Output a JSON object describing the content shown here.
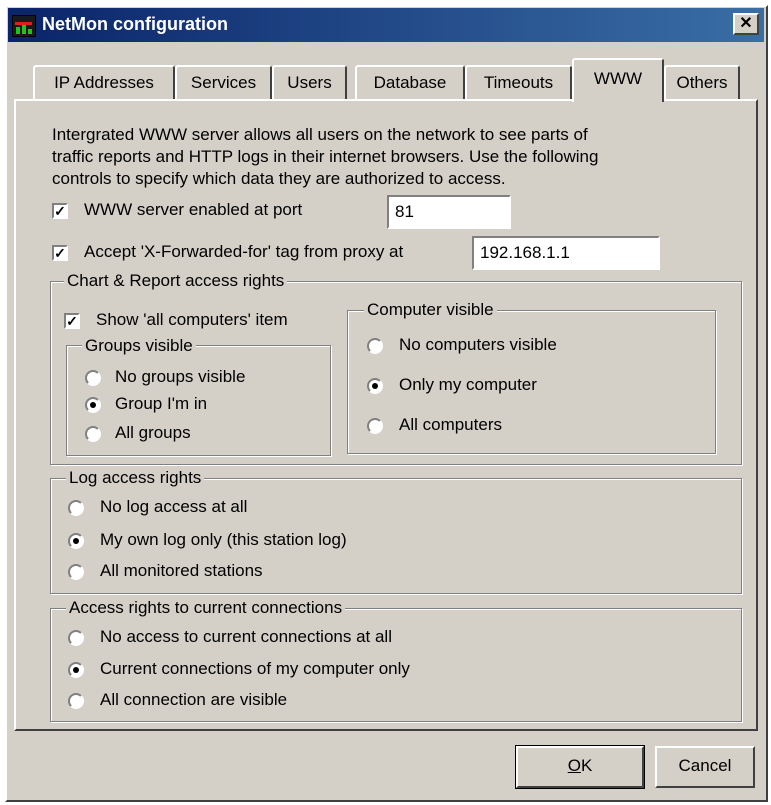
{
  "window": {
    "title": "NetMon configuration",
    "close_glyph": "✕",
    "icon": "netmon-app-icon"
  },
  "tabs": [
    {
      "label": "IP Addresses",
      "active": false
    },
    {
      "label": "Services",
      "active": false
    },
    {
      "label": "Users",
      "active": false
    },
    {
      "label": "Database",
      "active": false
    },
    {
      "label": "Timeouts",
      "active": false
    },
    {
      "label": "WWW",
      "active": true
    },
    {
      "label": "Others",
      "active": false
    }
  ],
  "intro": [
    "Intergrated WWW server allows all users on the network to see parts of",
    "traffic reports and  HTTP logs in their internet browsers.  Use the following",
    "controls to specify which data they are authorized to access."
  ],
  "www_server": {
    "label": "WWW server enabled at port",
    "checked": true,
    "port": "81"
  },
  "proxy": {
    "label": "Accept 'X-Forwarded-for' tag from proxy at",
    "checked": true,
    "address": "192.168.1.1"
  },
  "chart_report": {
    "legend": "Chart & Report access rights",
    "show_all": {
      "label": "Show 'all computers' item",
      "checked": true
    },
    "groups": {
      "legend": "Groups visible",
      "options": [
        "No groups visible",
        "Group I'm in",
        "All groups"
      ],
      "selected": 1
    },
    "computers": {
      "legend": "Computer visible",
      "options": [
        "No computers visible",
        "Only my computer",
        "All computers"
      ],
      "selected": 1
    }
  },
  "log_access": {
    "legend": "Log access rights",
    "options": [
      "No log access at all",
      "My own log only (this station log)",
      "All monitored stations"
    ],
    "selected": 1
  },
  "connections": {
    "legend": "Access rights to current connections",
    "options": [
      "No access to current connections at all",
      "Current connections of my computer only",
      "All connection are visible"
    ],
    "selected": 1
  },
  "buttons": {
    "ok_mnemonic": "O",
    "ok_rest": "K",
    "cancel": "Cancel"
  },
  "check_glyph": "✓"
}
